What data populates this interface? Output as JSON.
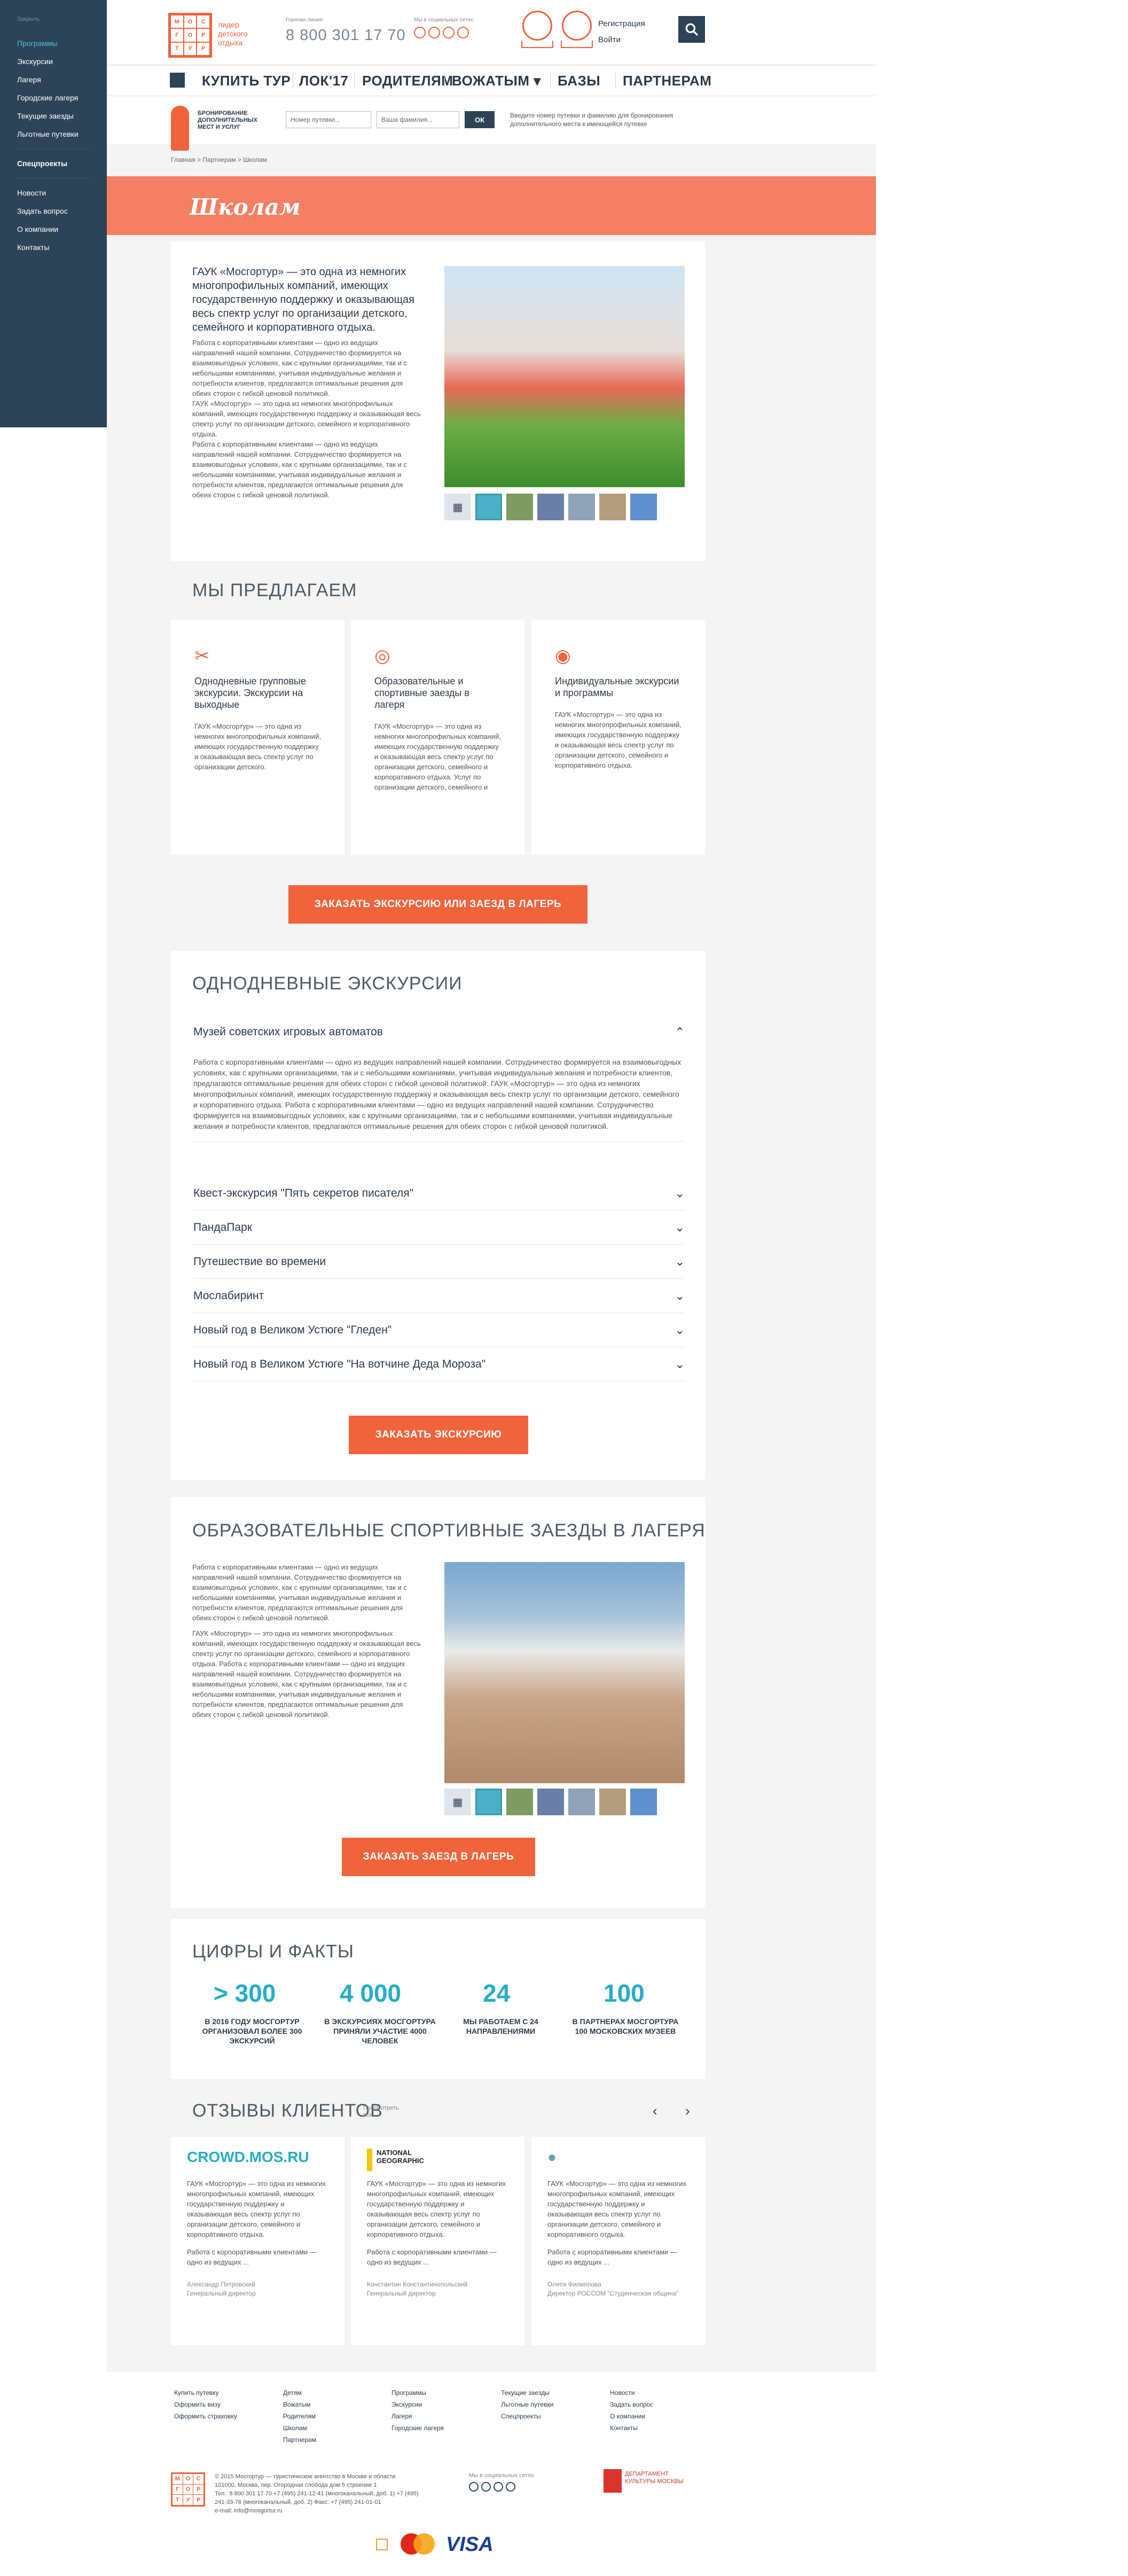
{
  "sidebar": {
    "close": "Закрыть",
    "items": [
      "Программы",
      "Экскурсии",
      "Лагеря",
      "Городские лагеря",
      "Текущие заезды",
      "Льготные путевки"
    ],
    "special": "Спецпроекты",
    "items2": [
      "Новости",
      "Задать вопрос",
      "О компании",
      "Контакты"
    ]
  },
  "header": {
    "logo": [
      "М",
      "О",
      "С",
      "Г",
      "О",
      "Р",
      "Т",
      "У",
      "Р"
    ],
    "tagline": [
      "лидер",
      "детского",
      "отдыха"
    ],
    "phone_label": "Горячая линия:",
    "phone": "8 800 301 17 70",
    "social_label": "Мы в социальных сетях:",
    "register": "Регистрация",
    "login": "Войти"
  },
  "nav": [
    "КУПИТЬ ТУР",
    "ЛОК'17",
    "РОДИТЕЛЯМ",
    "ВОЖАТЫМ ▾",
    "БАЗЫ",
    "ПАРТНЕРАМ"
  ],
  "booking": {
    "title": "БРОНИРОВАНИЕ ДОПОЛНИТЕЛЬНЫХ МЕСТ И УСЛУГ",
    "ph1": "Номер путевки...",
    "ph2": "Ваша фамилия...",
    "ok": "ОК",
    "note": "Введите номер путевки и фамилию для бронирования дополнительного места к имеющейся путевке"
  },
  "breadcrumb": "Главная   >   Партнерам   >   Школам",
  "banner_title": "Школам",
  "intro": {
    "lead": "ГАУК «Мосгортур» — это одна из немногих многопрофильных компаний, имеющих государственную поддержку и оказывающая весь спектр услуг по организации детского, семейного и корпоративного отдыха.",
    "body": [
      "Работа с корпоративными клиентами — одно из ведущих направлений нашей компании. Сотрудничество формируется на взаимовыгодных условиях, как с крупными организациями, так и с небольшими компаниями, учитывая индивидуальные желания и потребности клиентов, предлагаются оптимальные решения для обеих сторон с гибкой ценовой политикой.",
      "ГАУК «Мосгортур» — это одна из немногих многопрофильных компаний, имеющих государственную поддержку и оказывающая весь спектр услуг по организации детского, семейного и корпоративного отдыха.",
      "Работа с корпоративными клиентами — одно из ведущих направлений нашей компании. Сотрудничество формируется на взаимовыгодных условиях, как с крупными организациями, так и с небольшими компаниями, учитывая индивидуальные желания и потребности клиентов, предлагаются оптимальные решения для обеих сторон с гибкой ценовой политикой."
    ]
  },
  "offer": {
    "title": "МЫ ПРЕДЛАГАЕМ",
    "cards": [
      {
        "icon": "✂",
        "title": "Однодневные групповые экскурсии. Экскурсии на выходные",
        "text": "ГАУК «Мосгортур» — это одна из немногих многопрофильных компаний, имеющих государственную поддержку и оказывающая весь спектр услуг по организации детского."
      },
      {
        "icon": "◎",
        "title": "Образовательные и спортивные заезды в лагеря",
        "text": "ГАУК «Мосгортур» — это одна из немногих многопрофильных компаний, имеющих государственную поддержку и оказывающая весь спектр услуг по организации детского, семейного и корпоративного отдыха. Услуг по организации детского, семейного и"
      },
      {
        "icon": "◉",
        "title": "Индивидуальные экскурсии и программы",
        "text": "ГАУК «Мосгортур» — это одна из немногих многопрофильных компаний, имеющих государственную поддержку и оказывающая весь спектр услуг по организации детского, семейного и корпоративного отдыха."
      }
    ],
    "button": "ЗАКАЗАТЬ ЭКСКУРСИЮ ИЛИ ЗАЕЗД В ЛАГЕРЬ"
  },
  "excursions": {
    "title": "ОДНОДНЕВНЫЕ ЭКСКУРСИИ",
    "open_title": "Музей советских игровых автоматов",
    "open_text": "Работа с корпоративными клиентами — одно из ведущих направлений нашей компании. Сотрудничество формируется на взаимовыгодных условиях, как с крупными организациями, так и с небольшими компаниями, учитывая индивидуальные желания и потребности клиентов, предлагаются оптимальные решения для обеих сторон с гибкой ценовой политикой. ГАУК «Мосгортур» — это одна из немногих многопрофильных компаний, имеющих государственную поддержку и оказывающая весь спектр услуг по организации детского, семейного и корпоративного отдыха. Работа с корпоративными клиентами — одно из ведущих направлений нашей компании. Сотрудничество формируется на взаимовыгодных условиях, как с крупными организациями, так и с небольшими компаниями, учитывая индивидуальные желания и потребности клиентов, предлагаются оптимальные решения для обеих сторон с гибкой ценовой политикой.",
    "items": [
      "Квест-экскурсия \"Пять секретов писателя\"",
      "ПандаПарк",
      "Путешествие во времени",
      "Мослабиринт",
      "Новый год в Великом Устюге \"Гледен\"",
      "Новый год в Великом Устюге \"На вотчине Деда Мороза\""
    ],
    "button": "ЗАКАЗАТЬ ЭКСКУРСИЮ"
  },
  "camps": {
    "title": "ОБРАЗОВАТЕЛЬНЫЕ СПОРТИВНЫЕ ЗАЕЗДЫ В ЛАГЕРЯ",
    "body": [
      "Работа с корпоративными клиентами — одно из ведущих направлений нашей компании. Сотрудничество формируется на взаимовыгодных условиях, как с крупными организациями, так и с небольшими компаниями, учитывая индивидуальные желания и потребности клиентов, предлагаются оптимальные решения для обеих сторон с гибкой ценовой политикой.",
      "ГАУК «Мосгортур» — это одна из немногих многопрофильных компаний, имеющих государственную поддержку и оказывающая весь спектр услуг по организации детского, семейного и корпоративного отдыха. Работа с корпоративными клиентами — одно из ведущих направлений нашей компании. Сотрудничество формируется на взаимовыгодных условиях, как с крупными организациями, так и с небольшими компаниями, учитывая индивидуальные желания и потребности клиентов, предлагаются оптимальные решения для обеих сторон с гибкой ценовой политикой."
    ],
    "button": "ЗАКАЗАТЬ ЗАЕЗД В ЛАГЕРЬ"
  },
  "facts": {
    "title": "ЦИФРЫ И ФАКТЫ",
    "items": [
      {
        "n": "> 300",
        "l": "В 2016 ГОДУ МОСГОРТУР ОРГАНИЗОВАЛ БОЛЕЕ 300 ЭКСКУРСИЙ"
      },
      {
        "n": "4 000",
        "l": "В ЭКСКУРСИЯХ МОСГОРТУРА ПРИНЯЛИ УЧАСТИЕ 4000 ЧЕЛОВЕК"
      },
      {
        "n": "24",
        "l": "МЫ РАБОТАЕМ С 24 НАПРАВЛЕНИЯМИ"
      },
      {
        "n": "100",
        "l": "В ПАРТНЕРАХ МОСГОРТУРА 100 МОСКОВСКИХ МУЗЕЕВ"
      }
    ]
  },
  "reviews": {
    "title": "ОТЗЫВЫ КЛИЕНТОВ",
    "see_all": "Просмотреть все",
    "items": [
      {
        "logo": "CROWD.MOS.RU",
        "text": "ГАУК «Мосгортур» — это одна из немногих многопрофильных компаний, имеющих государственную поддержку и оказывающая весь спектр услуг по организации детского, семейного и корпоративного отдыха.",
        "text2": "Работа с корпоративными клиентами — одно из ведущих ...",
        "author": "Александр Петровский",
        "role": "Генеральный директор"
      },
      {
        "logo": "NATIONAL GEOGRAPHIC",
        "text": "ГАУК «Мосгортур» — это одна из немногих многопрофильных компаний, имеющих государственную поддержку и оказывающая весь спектр услуг по организации детского, семейного и корпоративного отдыха.",
        "text2": "Работа с корпоративными клиентами — одно из ведущих ...",
        "author": "Константин Константинопольский",
        "role": "Генеральный директор"
      },
      {
        "logo": "●",
        "text": "ГАУК «Мосгортур» — это одна из немногих многопрофильных компаний, имеющих государственную поддержку и оказывающая весь спектр услуг по организации детского, семейного и корпоративного отдыха.",
        "text2": "Работа с корпоративными клиентами — одно из ведущих ...",
        "author": "Олеся Филиппова",
        "role": "Директор РОССОМ \"Студенческая община\""
      }
    ]
  },
  "footer": {
    "cols": [
      [
        "Купить путевку",
        "Оформить визу",
        "Оформить страховку"
      ],
      [
        "Детям",
        "Вожатым",
        "Родителям",
        "Школам",
        "Партнерам"
      ],
      [
        "Программы",
        "Экскурсии",
        "Лагеря",
        "Городские лагеря"
      ],
      [
        "Текущие заезды",
        "Льготные путевки",
        "Спецпроекты"
      ],
      [
        "Новости",
        "Задать вопрос",
        "О компании",
        "Контакты"
      ]
    ],
    "copy": "© 2015 Мосгортур — туристическое агентство в Москве и области",
    "addr": "101000, Москва, пер. Огородная слобода дом 5 строение 1",
    "tel": "Тел.: 8 800 301 17 70  +7 (495) 241-12-41 (многоканальный, доб. 1)  +7 (495) 241-33-76 (многоканальный, доб. 2)  Факс: +7 (495) 241-01-01",
    "email": "e-mail: info@mosgortur.ru",
    "social": "Мы в социальных сетях",
    "dept": "ДЕПАРТАМЕНТ КУЛЬТУРЫ МОСКВЫ",
    "pay": [
      "mastercard",
      "VISA"
    ]
  }
}
